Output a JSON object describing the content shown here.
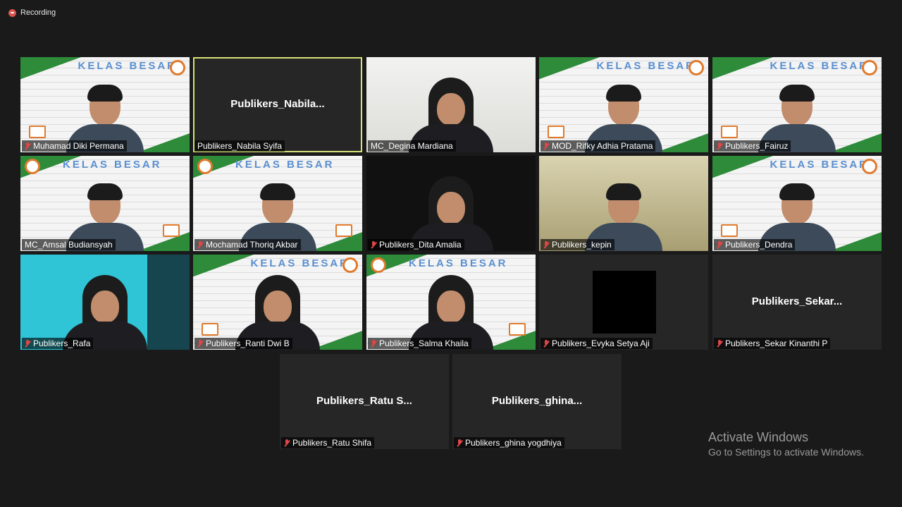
{
  "recording": {
    "label": "Recording",
    "color": "#d9534f"
  },
  "tiles": [
    {
      "name": "Muhamad Diki Permana",
      "kind": "video",
      "bg": "kelas",
      "muted": true
    },
    {
      "name": "Publikers_Nabila Syifa",
      "display": "Publikers_Nabila...",
      "kind": "name-only",
      "active": true,
      "muted": false
    },
    {
      "name": "MC_Degina Mardiana",
      "kind": "video",
      "bg": "white",
      "muted": false
    },
    {
      "name": "MOD_Rifky Adhia Pratama",
      "kind": "video",
      "bg": "kelas",
      "muted": true
    },
    {
      "name": "Publikers_Fairuz",
      "kind": "video",
      "bg": "kelas",
      "muted": true
    },
    {
      "name": "MC_Amsal Budiansyah",
      "kind": "video",
      "bg": "kelas-mirror",
      "muted": false
    },
    {
      "name": "Mochamad Thoriq Akbar",
      "kind": "video",
      "bg": "kelas-mirror",
      "muted": true
    },
    {
      "name": "Publikers_Dita Amalia",
      "kind": "video",
      "bg": "dark",
      "muted": true
    },
    {
      "name": "Publikers_kepin",
      "kind": "video",
      "bg": "room",
      "muted": true
    },
    {
      "name": "Publikers_Dendra",
      "kind": "video",
      "bg": "kelas",
      "muted": true
    },
    {
      "name": "Publikers_Rafa",
      "kind": "video",
      "bg": "teal",
      "muted": true
    },
    {
      "name": "Publikers_Ranti Dwi B",
      "kind": "video",
      "bg": "kelas",
      "muted": true
    },
    {
      "name": "Publikers_Salma Khaila",
      "kind": "video",
      "bg": "kelas-mirror",
      "muted": true
    },
    {
      "name": "Publikers_Evyka Setya Aji",
      "kind": "blank",
      "muted": true
    },
    {
      "name": "Publikers_Sekar Kinanthi P",
      "display": "Publikers_Sekar...",
      "kind": "name-only",
      "muted": true
    },
    {
      "name": "Publikers_Ratu Shifa",
      "display": "Publikers_Ratu  S...",
      "kind": "name-only",
      "muted": true
    },
    {
      "name": "Publikers_ghina yogdhiya",
      "display": "Publikers_ghina...",
      "kind": "name-only",
      "muted": true
    }
  ],
  "kelas_besar_text": "KELAS BESAR",
  "watermark": {
    "title": "Activate Windows",
    "subtitle": "Go to Settings to activate Windows."
  }
}
